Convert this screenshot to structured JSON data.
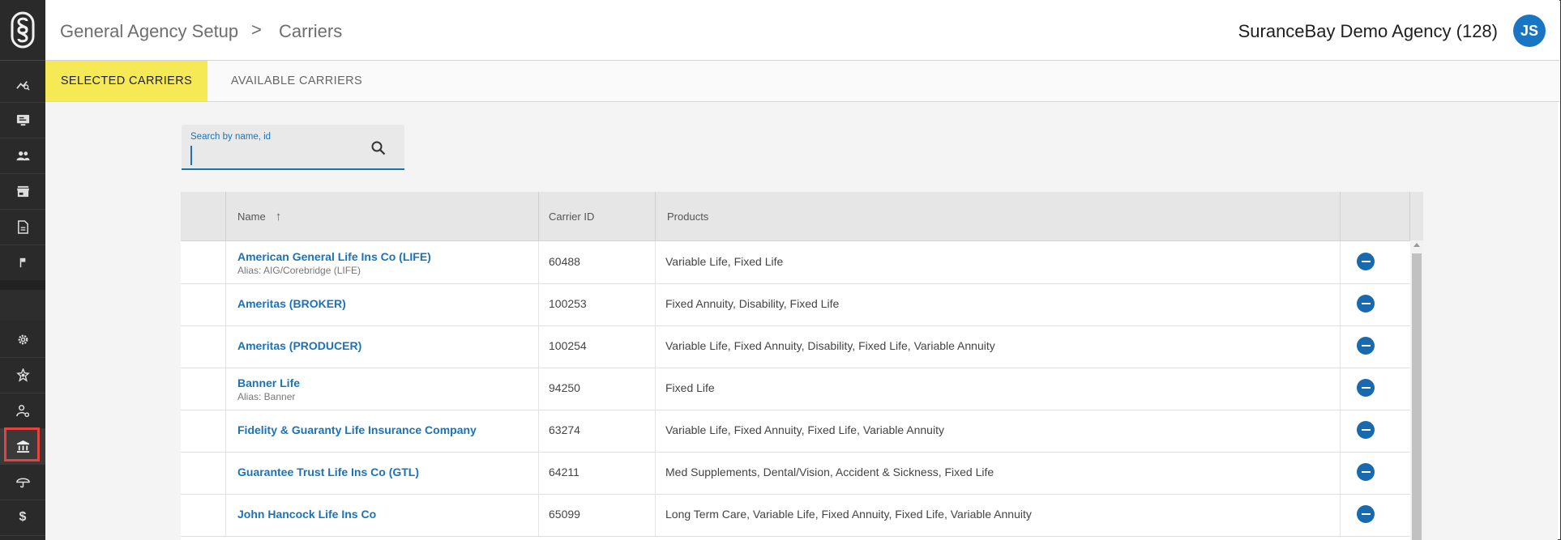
{
  "header": {
    "breadcrumb": [
      "General Agency Setup",
      "Carriers"
    ],
    "separator": ">",
    "agency_name": "SuranceBay Demo Agency (128)",
    "user_initials": "JS"
  },
  "tabs": [
    {
      "label": "SELECTED CARRIERS",
      "active": true
    },
    {
      "label": "AVAILABLE CARRIERS",
      "active": false
    }
  ],
  "search": {
    "label": "Search by name, id",
    "value": ""
  },
  "table": {
    "columns": [
      "",
      "Name",
      "Carrier ID",
      "Products",
      ""
    ],
    "sort_indicator": "↑",
    "rows": [
      {
        "name": "American General Life Ins Co (LIFE)",
        "alias": "Alias: AIG/Corebridge (LIFE)",
        "carrier_id": "60488",
        "products": "Variable Life, Fixed Life"
      },
      {
        "name": "Ameritas (BROKER)",
        "alias": "",
        "carrier_id": "100253",
        "products": "Fixed Annuity, Disability, Fixed Life"
      },
      {
        "name": "Ameritas (PRODUCER)",
        "alias": "",
        "carrier_id": "100254",
        "products": "Variable Life, Fixed Annuity, Disability, Fixed Life, Variable Annuity"
      },
      {
        "name": "Banner Life",
        "alias": "Alias: Banner",
        "carrier_id": "94250",
        "products": "Fixed Life"
      },
      {
        "name": "Fidelity & Guaranty Life Insurance Company",
        "alias": "",
        "carrier_id": "63274",
        "products": "Variable Life, Fixed Annuity, Fixed Life, Variable Annuity"
      },
      {
        "name": "Guarantee Trust Life Ins Co (GTL)",
        "alias": "",
        "carrier_id": "64211",
        "products": "Med Supplements, Dental/Vision, Accident & Sickness, Fixed Life"
      },
      {
        "name": "John Hancock Life Ins Co",
        "alias": "",
        "carrier_id": "65099",
        "products": "Long Term Care, Variable Life, Fixed Annuity, Fixed Life, Variable Annuity"
      }
    ]
  },
  "sidebar": {
    "items": [
      {
        "icon": "analytics-icon"
      },
      {
        "icon": "monitor-icon"
      },
      {
        "icon": "people-icon"
      },
      {
        "icon": "store-icon"
      },
      {
        "icon": "document-icon"
      },
      {
        "icon": "flag-icon"
      },
      {
        "icon": "gear-icon"
      },
      {
        "icon": "badge-icon"
      },
      {
        "icon": "user-settings-icon"
      },
      {
        "icon": "bank-icon",
        "active": true
      },
      {
        "icon": "umbrella-icon"
      },
      {
        "icon": "dollar-icon"
      }
    ]
  },
  "colors": {
    "accent": "#1a73b8",
    "active_tab": "#f5ea55",
    "sidebar": "#2a2a2a",
    "highlight": "#e8423f"
  }
}
